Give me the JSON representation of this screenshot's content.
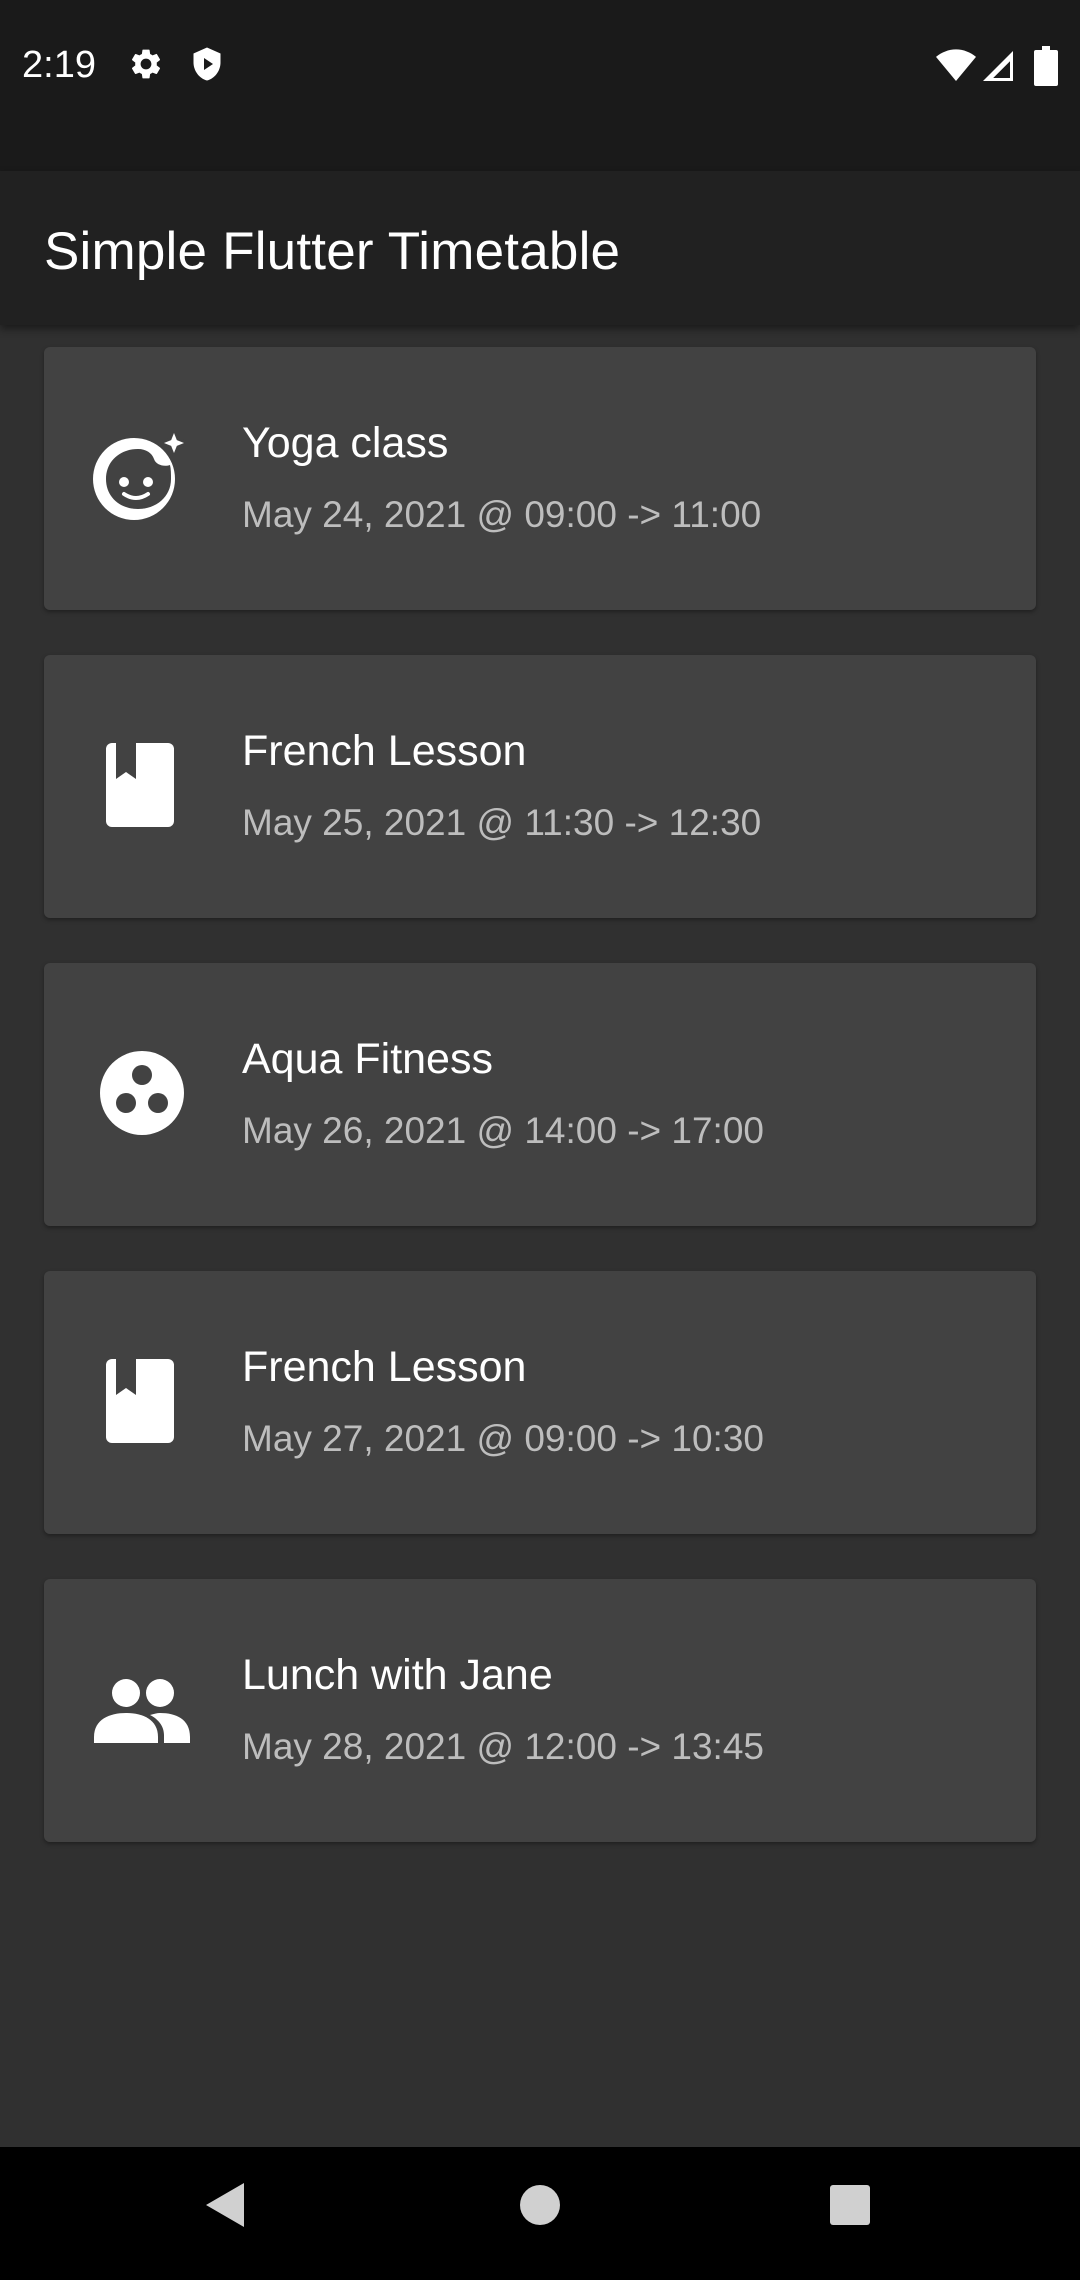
{
  "status_bar": {
    "time": "2:19",
    "left_icons": [
      "gear-icon",
      "shield-play-icon"
    ],
    "right_icons": [
      "wifi-icon",
      "signal-icon",
      "battery-icon"
    ]
  },
  "app_bar": {
    "title": "Simple Flutter Timetable"
  },
  "events": [
    {
      "title": "Yoga class",
      "subtitle": "May 24, 2021 @ 09:00 -> 11:00",
      "icon": "face-sparkle-icon"
    },
    {
      "title": "French Lesson",
      "subtitle": "May 25, 2021 @ 11:30 -> 12:30",
      "icon": "book-icon"
    },
    {
      "title": "Aqua Fitness",
      "subtitle": "May 26, 2021 @ 14:00 -> 17:00",
      "icon": "bowling-ball-icon"
    },
    {
      "title": "French Lesson",
      "subtitle": "May 27, 2021 @ 09:00 -> 10:30",
      "icon": "book-icon"
    },
    {
      "title": "Lunch with Jane",
      "subtitle": "May 28, 2021 @ 12:00 -> 13:45",
      "icon": "people-icon"
    }
  ],
  "nav_bar": {
    "buttons": [
      "back-icon",
      "home-icon",
      "recents-icon"
    ]
  }
}
